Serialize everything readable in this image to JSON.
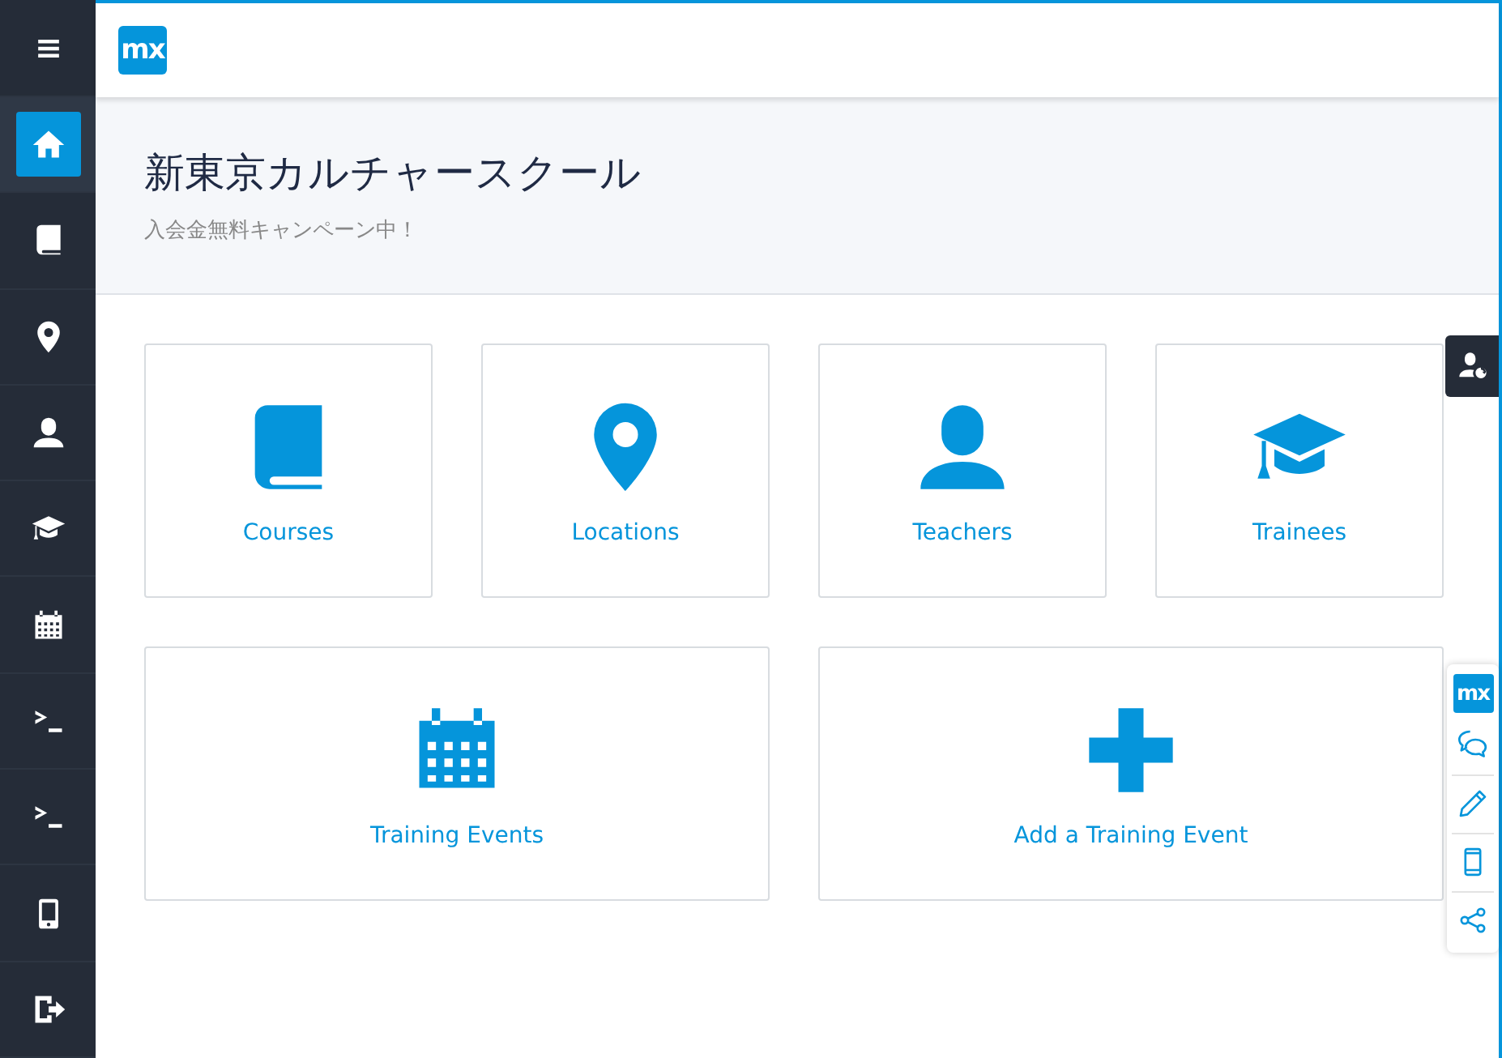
{
  "sidebar": {
    "items": [
      {
        "kind": "menu",
        "selected": false
      },
      {
        "kind": "home",
        "selected": true
      },
      {
        "kind": "book",
        "selected": false
      },
      {
        "kind": "pin",
        "selected": false
      },
      {
        "kind": "person",
        "selected": false
      },
      {
        "kind": "cap",
        "selected": false
      },
      {
        "kind": "calendar",
        "selected": false
      },
      {
        "kind": "terminal",
        "selected": false
      },
      {
        "kind": "terminal",
        "selected": false
      },
      {
        "kind": "phone",
        "selected": false
      },
      {
        "kind": "logout",
        "selected": false
      }
    ]
  },
  "header": {
    "logo": "mx"
  },
  "hero": {
    "title": "新東京カルチャースクール",
    "subtitle": "入会金無料キャンペーン中！"
  },
  "tile_rows": [
    [
      {
        "label": "Courses",
        "kind": "book"
      },
      {
        "label": "Locations",
        "kind": "pin"
      },
      {
        "label": "Teachers",
        "kind": "person"
      },
      {
        "label": "Trainees",
        "kind": "cap"
      }
    ],
    [
      {
        "label": "Training Events",
        "kind": "calendar"
      },
      {
        "label": "Add a Training Event",
        "kind": "plus"
      }
    ]
  ],
  "dev_toolbar": {
    "logo": "mx",
    "tools": [
      {
        "kind": "chat"
      },
      {
        "kind": "pencil"
      },
      {
        "kind": "phone-outline"
      },
      {
        "kind": "share"
      }
    ]
  }
}
